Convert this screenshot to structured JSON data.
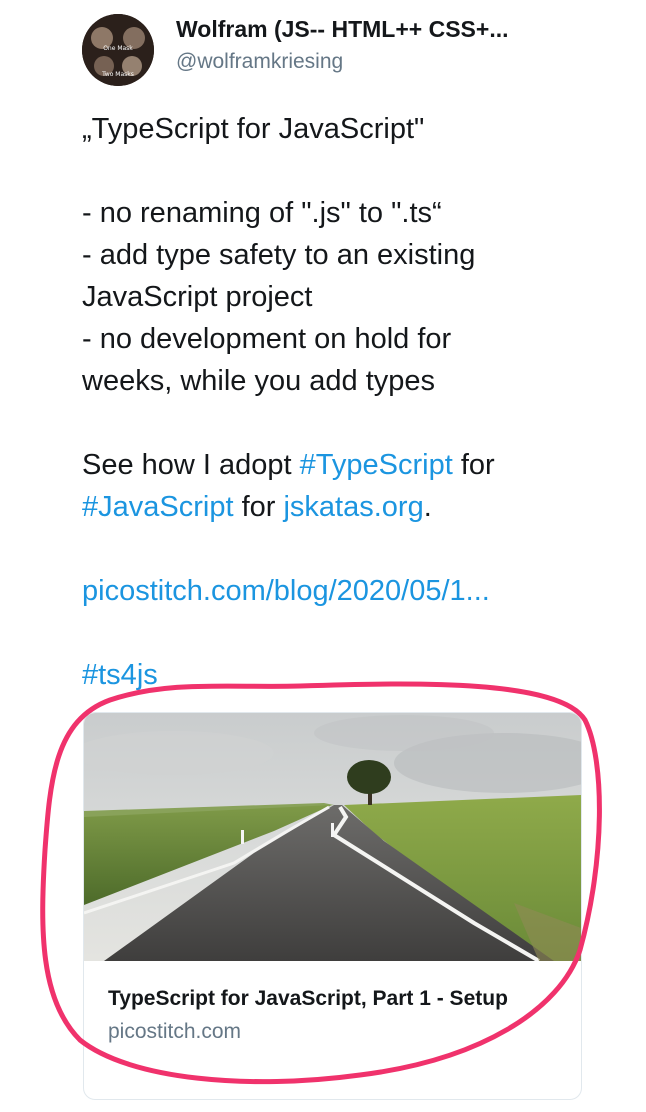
{
  "author": {
    "name": "Wolfram (JS-- HTML++ CSS+...",
    "handle": "@wolframkriesing",
    "avatar_text": [
      "One Mask",
      "Two Masks"
    ]
  },
  "tweet": {
    "line1": "„TypeScript for JavaScript\"",
    "line2": "- no renaming of \".js\" to \".ts“",
    "line3": "- add type safety to an existing",
    "line4": "JavaScript project",
    "line5": "- no development on hold for",
    "line6": "weeks, while you add types",
    "line7_pre": "See how I adopt ",
    "hashtag_typescript": "#TypeScript",
    "line7_post": " for",
    "hashtag_javascript": "#JavaScript",
    "line8_mid": " for ",
    "link_jskatas": "jskatas.org",
    "line8_end": ".",
    "link_blog": "picostitch.com/blog/2020/05/1...",
    "hashtag_ts4js": "#ts4js"
  },
  "card": {
    "title": "TypeScript for JavaScript, Part 1 - Setup",
    "domain": "picostitch.com"
  },
  "colors": {
    "link": "#1b95e0",
    "annotation": "#f0326c"
  }
}
